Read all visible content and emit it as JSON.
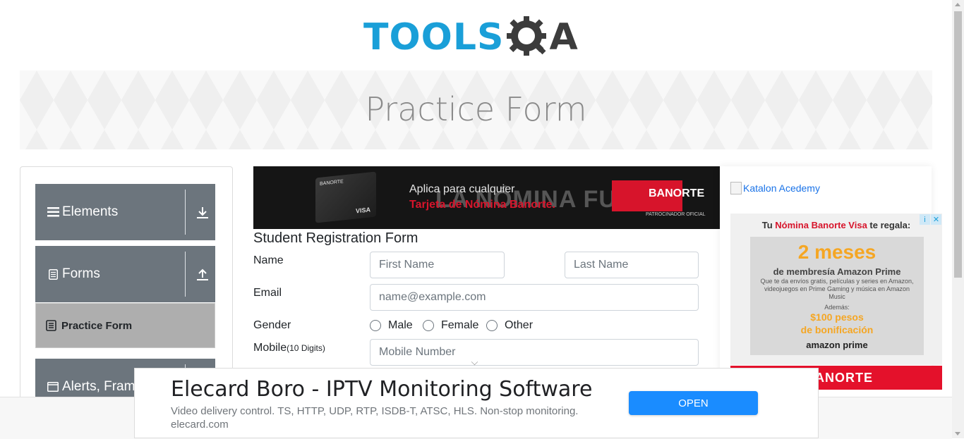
{
  "logo": {
    "text": "TOOLS",
    "q": "Q",
    "a": "A"
  },
  "banner": {
    "title": "Practice Form"
  },
  "sidebar": {
    "groups": [
      {
        "label": "Elements",
        "icon": "hamburger-icon",
        "arrow": "download-arrow-icon"
      },
      {
        "label": "Forms",
        "icon": "document-icon",
        "arrow": "upload-arrow-icon"
      },
      {
        "label": "Alerts, Fram",
        "icon": "window-icon"
      }
    ],
    "active_item": {
      "label": "Practice Form",
      "icon": "form-icon"
    }
  },
  "main_ad": {
    "line1": "Aplica para cualquier",
    "line2": "Tarjeta de Nómina Banorte.",
    "watermark": "LA NÓMINA FUERTE",
    "brand": "BANORTE",
    "card_brand": "BANORTE",
    "card_visa": "VISA",
    "sponsor": "PATROCINADOR OFICIAL"
  },
  "form": {
    "title": "Student Registration Form",
    "name_label": "Name",
    "first_name_placeholder": "First Name",
    "last_name_placeholder": "Last Name",
    "email_label": "Email",
    "email_placeholder": "name@example.com",
    "gender_label": "Gender",
    "gender_options": [
      "Male",
      "Female",
      "Other"
    ],
    "mobile_label": "Mobile",
    "mobile_hint": "(10 Digits)",
    "mobile_placeholder": "Mobile Number"
  },
  "right": {
    "katalon_alt": "Katalon Acedemy",
    "ad": {
      "head_prefix": "Tu ",
      "head_red": "Nómina Banorte Visa",
      "head_suffix": " te regala:",
      "big": "2 meses",
      "bold": "de membresía Amazon Prime",
      "small": "Que te da envíos gratis, películas y series en Amazon, videojuegos en Prime Gaming y música en Amazon Music",
      "ademas": "Además:",
      "orange1": "$100 pesos",
      "orange2": "de bonificación",
      "amazon": "amazon prime"
    },
    "strip_text": "ANORTE"
  },
  "bottom_ad": {
    "title": "Elecard Boro - IPTV Monitoring Software",
    "desc": "Video delivery control. TS, HTTP, UDP, RTP, ISDB-T, ATSC, HLS. Non-stop monitoring.",
    "domain": "elecard.com",
    "button": "OPEN"
  },
  "colors": {
    "brand_blue": "#1a9fd8",
    "sidebar_gray": "#6c757d",
    "banorte_red": "#e4112b",
    "open_blue": "#1a8cff"
  }
}
